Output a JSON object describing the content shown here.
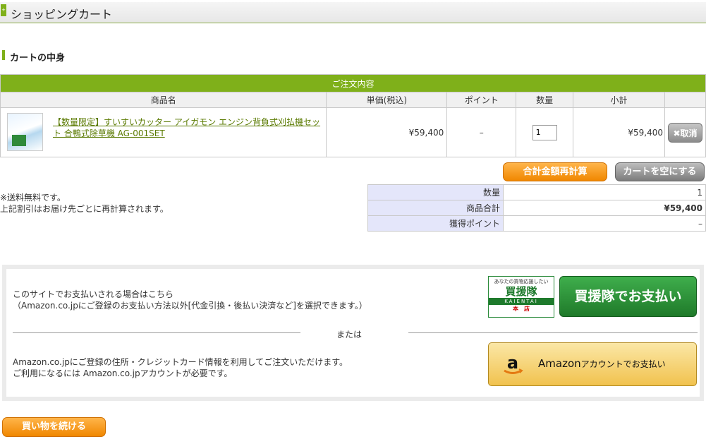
{
  "header": {
    "title": "ショッピングカート",
    "marker_glyph": "+"
  },
  "section": {
    "title": "カートの中身"
  },
  "cart": {
    "caption": "ご注文内容",
    "columns": [
      "商品名",
      "単価(税込)",
      "ポイント",
      "数量",
      "小計",
      ""
    ],
    "items": [
      {
        "name": "【数量限定】すいすいカッター アイガモン エンジン背負式刈払機セット 合鴨式除草機 AG-001SET",
        "unit_price": "¥59,400",
        "points": "–",
        "quantity": "1",
        "subtotal": "¥59,400",
        "delete_label": "✖取消"
      }
    ]
  },
  "buttons": {
    "recalc": "合計金額再計算",
    "empty": "カートを空にする",
    "continue": "買い物を続ける"
  },
  "notes": [
    "※送料無料です。",
    "上記割引はお届け先ごとに再計算されます。"
  ],
  "summary": [
    {
      "label": "数量",
      "value": "1"
    },
    {
      "label": "商品合計",
      "value": "¥59,400"
    },
    {
      "label": "獲得ポイント",
      "value": "–"
    }
  ],
  "payment": {
    "kaientai_text_1": "このサイトでお支払いされる場合はこちら",
    "kaientai_text_2": "（Amazon.co.jpにご登録のお支払い方法以外[代金引換・後払い決済など]を選択できます。）",
    "or": "または",
    "amazon_text_1": "Amazon.co.jpにご登録の住所・クレジットカード情報を利用してご注文いただけます。",
    "amazon_text_2": "ご利用になるには Amazon.co.jpアカウントが必要です。",
    "kaientai_logo": {
      "top": "あなたの買物応援したい",
      "main": "買援隊",
      "band": "KAIENTAI",
      "bottom": "本　店"
    },
    "kaientai_button": "買援隊でお支払い",
    "amazon_button_main": "Amazon",
    "amazon_button_sub": "アカウントでお支払い"
  },
  "colors": {
    "accent_green": "#7fb01a",
    "orange": "#f08700",
    "kaientai_green": "#1f7a2a",
    "amazon_yellow": "#f1c24e"
  }
}
